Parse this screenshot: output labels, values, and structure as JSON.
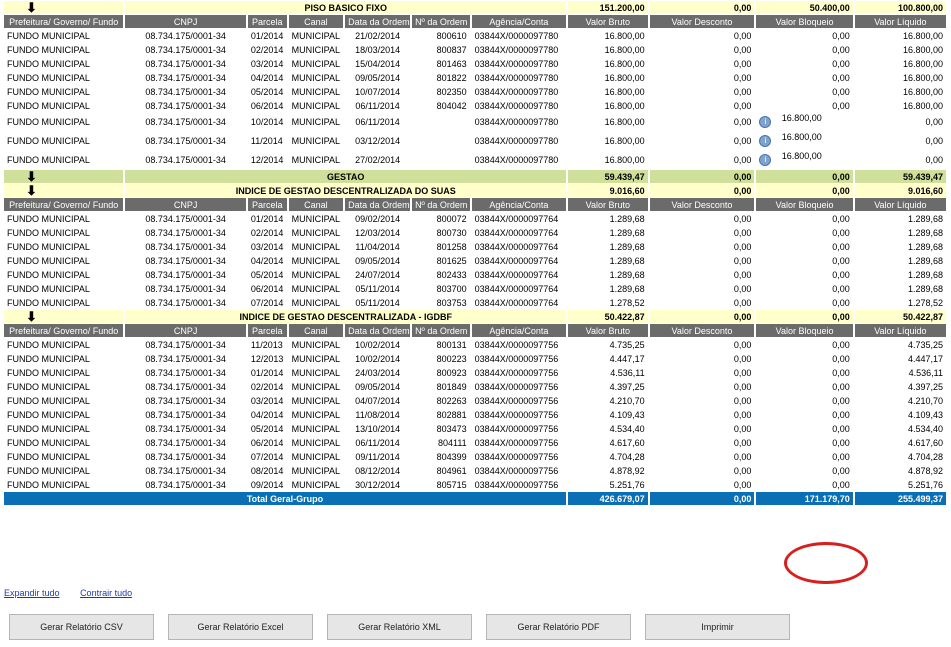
{
  "columns": [
    "Prefeitura/ Governo/ Fundo",
    "CNPJ",
    "Parcela",
    "Canal",
    "Data da Ordem",
    "Nº da Ordem",
    "Agência/Conta",
    "Valor Bruto",
    "Valor Desconto",
    "Valor Bloqueio",
    "Valor Líquido"
  ],
  "groups": [
    {
      "title": "PISO BASICO FIXO",
      "arrow": true,
      "green": false,
      "bruto": "151.200,00",
      "desconto": "0,00",
      "bloqueio": "50.400,00",
      "liquido": "100.800,00",
      "show_header": true,
      "rows": [
        [
          "FUNDO MUNICIPAL",
          "08.734.175/0001-34",
          "01/2014",
          "MUNICIPAL",
          "21/02/2014",
          "800610",
          "03844X/0000097780",
          "16.800,00",
          "0,00",
          "0,00",
          "16.800,00"
        ],
        [
          "FUNDO MUNICIPAL",
          "08.734.175/0001-34",
          "02/2014",
          "MUNICIPAL",
          "18/03/2014",
          "800837",
          "03844X/0000097780",
          "16.800,00",
          "0,00",
          "0,00",
          "16.800,00"
        ],
        [
          "FUNDO MUNICIPAL",
          "08.734.175/0001-34",
          "03/2014",
          "MUNICIPAL",
          "15/04/2014",
          "801463",
          "03844X/0000097780",
          "16.800,00",
          "0,00",
          "0,00",
          "16.800,00"
        ],
        [
          "FUNDO MUNICIPAL",
          "08.734.175/0001-34",
          "04/2014",
          "MUNICIPAL",
          "09/05/2014",
          "801822",
          "03844X/0000097780",
          "16.800,00",
          "0,00",
          "0,00",
          "16.800,00"
        ],
        [
          "FUNDO MUNICIPAL",
          "08.734.175/0001-34",
          "05/2014",
          "MUNICIPAL",
          "10/07/2014",
          "802350",
          "03844X/0000097780",
          "16.800,00",
          "0,00",
          "0,00",
          "16.800,00"
        ],
        [
          "FUNDO MUNICIPAL",
          "08.734.175/0001-34",
          "06/2014",
          "MUNICIPAL",
          "06/11/2014",
          "804042",
          "03844X/0000097780",
          "16.800,00",
          "0,00",
          "0,00",
          "16.800,00"
        ],
        [
          "FUNDO MUNICIPAL",
          "08.734.175/0001-34",
          "10/2014",
          "MUNICIPAL",
          "06/11/2014",
          "",
          "03844X/0000097780",
          "16.800,00",
          "0,00",
          "16.800,00",
          "0,00",
          "info"
        ],
        [
          "FUNDO MUNICIPAL",
          "08.734.175/0001-34",
          "11/2014",
          "MUNICIPAL",
          "03/12/2014",
          "",
          "03844X/0000097780",
          "16.800,00",
          "0,00",
          "16.800,00",
          "0,00",
          "info"
        ],
        [
          "FUNDO MUNICIPAL",
          "08.734.175/0001-34",
          "12/2014",
          "MUNICIPAL",
          "27/02/2014",
          "",
          "03844X/0000097780",
          "16.800,00",
          "0,00",
          "16.800,00",
          "0,00",
          "info"
        ]
      ]
    },
    {
      "title": "GESTAO",
      "arrow": true,
      "green": true,
      "bruto": "59.439,47",
      "desconto": "0,00",
      "bloqueio": "0,00",
      "liquido": "59.439,47",
      "show_header": false,
      "rows": []
    },
    {
      "title": "INDICE DE GESTAO DESCENTRALIZADA DO SUAS",
      "arrow": true,
      "green": false,
      "bruto": "9.016,60",
      "desconto": "0,00",
      "bloqueio": "0,00",
      "liquido": "9.016,60",
      "show_header": true,
      "rows": [
        [
          "FUNDO MUNICIPAL",
          "08.734.175/0001-34",
          "01/2014",
          "MUNICIPAL",
          "09/02/2014",
          "800072",
          "03844X/0000097764",
          "1.289,68",
          "0,00",
          "0,00",
          "1.289,68"
        ],
        [
          "FUNDO MUNICIPAL",
          "08.734.175/0001-34",
          "02/2014",
          "MUNICIPAL",
          "12/03/2014",
          "800730",
          "03844X/0000097764",
          "1.289,68",
          "0,00",
          "0,00",
          "1.289,68"
        ],
        [
          "FUNDO MUNICIPAL",
          "08.734.175/0001-34",
          "03/2014",
          "MUNICIPAL",
          "11/04/2014",
          "801258",
          "03844X/0000097764",
          "1.289,68",
          "0,00",
          "0,00",
          "1.289,68"
        ],
        [
          "FUNDO MUNICIPAL",
          "08.734.175/0001-34",
          "04/2014",
          "MUNICIPAL",
          "09/05/2014",
          "801625",
          "03844X/0000097764",
          "1.289,68",
          "0,00",
          "0,00",
          "1.289,68"
        ],
        [
          "FUNDO MUNICIPAL",
          "08.734.175/0001-34",
          "05/2014",
          "MUNICIPAL",
          "24/07/2014",
          "802433",
          "03844X/0000097764",
          "1.289,68",
          "0,00",
          "0,00",
          "1.289,68"
        ],
        [
          "FUNDO MUNICIPAL",
          "08.734.175/0001-34",
          "06/2014",
          "MUNICIPAL",
          "05/11/2014",
          "803700",
          "03844X/0000097764",
          "1.289,68",
          "0,00",
          "0,00",
          "1.289,68"
        ],
        [
          "FUNDO MUNICIPAL",
          "08.734.175/0001-34",
          "07/2014",
          "MUNICIPAL",
          "05/11/2014",
          "803753",
          "03844X/0000097764",
          "1.278,52",
          "0,00",
          "0,00",
          "1.278,52"
        ]
      ]
    },
    {
      "title": "INDICE DE GESTAO DESCENTRALIZADA - IGDBF",
      "arrow": true,
      "green": false,
      "bruto": "50.422,87",
      "desconto": "0,00",
      "bloqueio": "0,00",
      "liquido": "50.422,87",
      "show_header": true,
      "rows": [
        [
          "FUNDO MUNICIPAL",
          "08.734.175/0001-34",
          "11/2013",
          "MUNICIPAL",
          "10/02/2014",
          "800131",
          "03844X/0000097756",
          "4.735,25",
          "0,00",
          "0,00",
          "4.735,25"
        ],
        [
          "FUNDO MUNICIPAL",
          "08.734.175/0001-34",
          "12/2013",
          "MUNICIPAL",
          "10/02/2014",
          "800223",
          "03844X/0000097756",
          "4.447,17",
          "0,00",
          "0,00",
          "4.447,17"
        ],
        [
          "FUNDO MUNICIPAL",
          "08.734.175/0001-34",
          "01/2014",
          "MUNICIPAL",
          "24/03/2014",
          "800923",
          "03844X/0000097756",
          "4.536,11",
          "0,00",
          "0,00",
          "4.536,11"
        ],
        [
          "FUNDO MUNICIPAL",
          "08.734.175/0001-34",
          "02/2014",
          "MUNICIPAL",
          "09/05/2014",
          "801849",
          "03844X/0000097756",
          "4.397,25",
          "0,00",
          "0,00",
          "4.397,25"
        ],
        [
          "FUNDO MUNICIPAL",
          "08.734.175/0001-34",
          "03/2014",
          "MUNICIPAL",
          "04/07/2014",
          "802263",
          "03844X/0000097756",
          "4.210,70",
          "0,00",
          "0,00",
          "4.210,70"
        ],
        [
          "FUNDO MUNICIPAL",
          "08.734.175/0001-34",
          "04/2014",
          "MUNICIPAL",
          "11/08/2014",
          "802881",
          "03844X/0000097756",
          "4.109,43",
          "0,00",
          "0,00",
          "4.109,43"
        ],
        [
          "FUNDO MUNICIPAL",
          "08.734.175/0001-34",
          "05/2014",
          "MUNICIPAL",
          "13/10/2014",
          "803473",
          "03844X/0000097756",
          "4.534,40",
          "0,00",
          "0,00",
          "4.534,40"
        ],
        [
          "FUNDO MUNICIPAL",
          "08.734.175/0001-34",
          "06/2014",
          "MUNICIPAL",
          "06/11/2014",
          "804111",
          "03844X/0000097756",
          "4.617,60",
          "0,00",
          "0,00",
          "4.617,60"
        ],
        [
          "FUNDO MUNICIPAL",
          "08.734.175/0001-34",
          "07/2014",
          "MUNICIPAL",
          "09/11/2014",
          "804399",
          "03844X/0000097756",
          "4.704,28",
          "0,00",
          "0,00",
          "4.704,28"
        ],
        [
          "FUNDO MUNICIPAL",
          "08.734.175/0001-34",
          "08/2014",
          "MUNICIPAL",
          "08/12/2014",
          "804961",
          "03844X/0000097756",
          "4.878,92",
          "0,00",
          "0,00",
          "4.878,92"
        ],
        [
          "FUNDO MUNICIPAL",
          "08.734.175/0001-34",
          "09/2014",
          "MUNICIPAL",
          "30/12/2014",
          "805715",
          "03844X/0000097756",
          "5.251,76",
          "0,00",
          "0,00",
          "5.251,76"
        ]
      ]
    }
  ],
  "total": {
    "label": "Total Geral-Grupo",
    "bruto": "426.679,07",
    "desconto": "0,00",
    "bloqueio": "171.179,70",
    "liquido": "255.499,37"
  },
  "links": {
    "expand": "Expandir tudo",
    "collapse": "Contrair tudo"
  },
  "buttons": [
    "Gerar Relatório CSV",
    "Gerar Relatório Excel",
    "Gerar Relatório XML",
    "Gerar Relatório PDF",
    "Imprimir"
  ],
  "annotation_color": "#d81f1f"
}
